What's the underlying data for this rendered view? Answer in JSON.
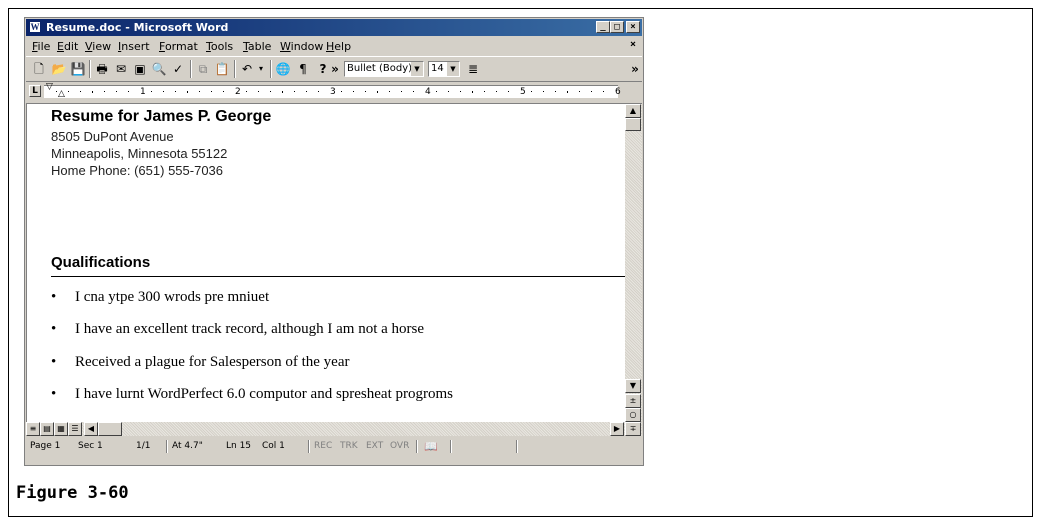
{
  "window": {
    "title": "Resume.doc - Microsoft Word",
    "app_icon": "W",
    "controls": [
      "_",
      "□",
      "×"
    ]
  },
  "menu": [
    "File",
    "Edit",
    "View",
    "Insert",
    "Format",
    "Tools",
    "Table",
    "Window",
    "Help"
  ],
  "toolbar": {
    "icons": [
      "new-icon",
      "open-icon",
      "save-icon",
      "print-icon",
      "print-preview-icon",
      "email-icon",
      "preview-icon",
      "spelling-icon",
      "copy-icon",
      "paste-icon",
      "undo-icon",
      "web-icon",
      "show-marks-icon",
      "help-icon"
    ],
    "style_combo": "Bullet (Body)",
    "size_combo": "14",
    "more": "»"
  },
  "ruler": {
    "tab_selector": "L",
    "numbers": [
      "1",
      "2",
      "3",
      "4",
      "5",
      "6"
    ]
  },
  "document": {
    "name": "Resume for James P. George",
    "address_lines": [
      "8505 DuPont Avenue",
      "Minneapolis, Minnesota 55122",
      "Home Phone: (651) 555-7036"
    ],
    "section_heading": "Qualifications",
    "bullets": [
      "I cna ytpe 300 wrods pre mniuet",
      "I have an excellent track record, although I am not a horse",
      "Received a plague for Salesperson of the year",
      "I have lurnt WordPerfect 6.0 computor and spresheat progroms"
    ]
  },
  "status": {
    "page": "Page 1",
    "sec": "Sec 1",
    "count": "1/1",
    "at": "At 4.7\"",
    "ln": "Ln 15",
    "col": "Col 1",
    "rec": "REC",
    "trk": "TRK",
    "ext": "EXT",
    "ovr": "OVR"
  },
  "caption": "Figure 3-60"
}
